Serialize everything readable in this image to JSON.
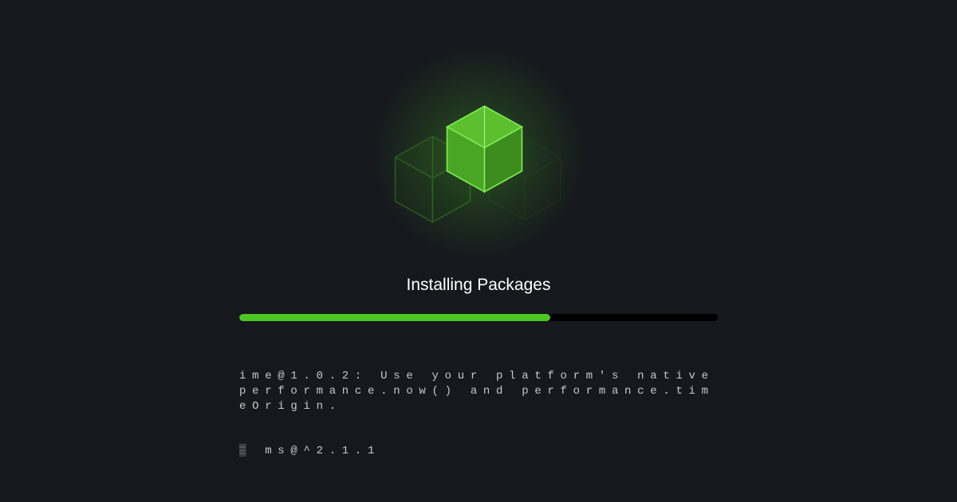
{
  "title": "Installing Packages",
  "progress_percent": 65,
  "colors": {
    "accent": "#4cc726",
    "background": "#16181d",
    "track": "#000000"
  },
  "cubes": {
    "main": "cube-icon",
    "left": "cube-icon",
    "right": "cube-icon"
  },
  "log": {
    "lines": [
      "ime@1.0.2: Use your platform's native performance.now() and performance.timeOrigin.",
      "▒ ms@^2.1.1"
    ]
  }
}
